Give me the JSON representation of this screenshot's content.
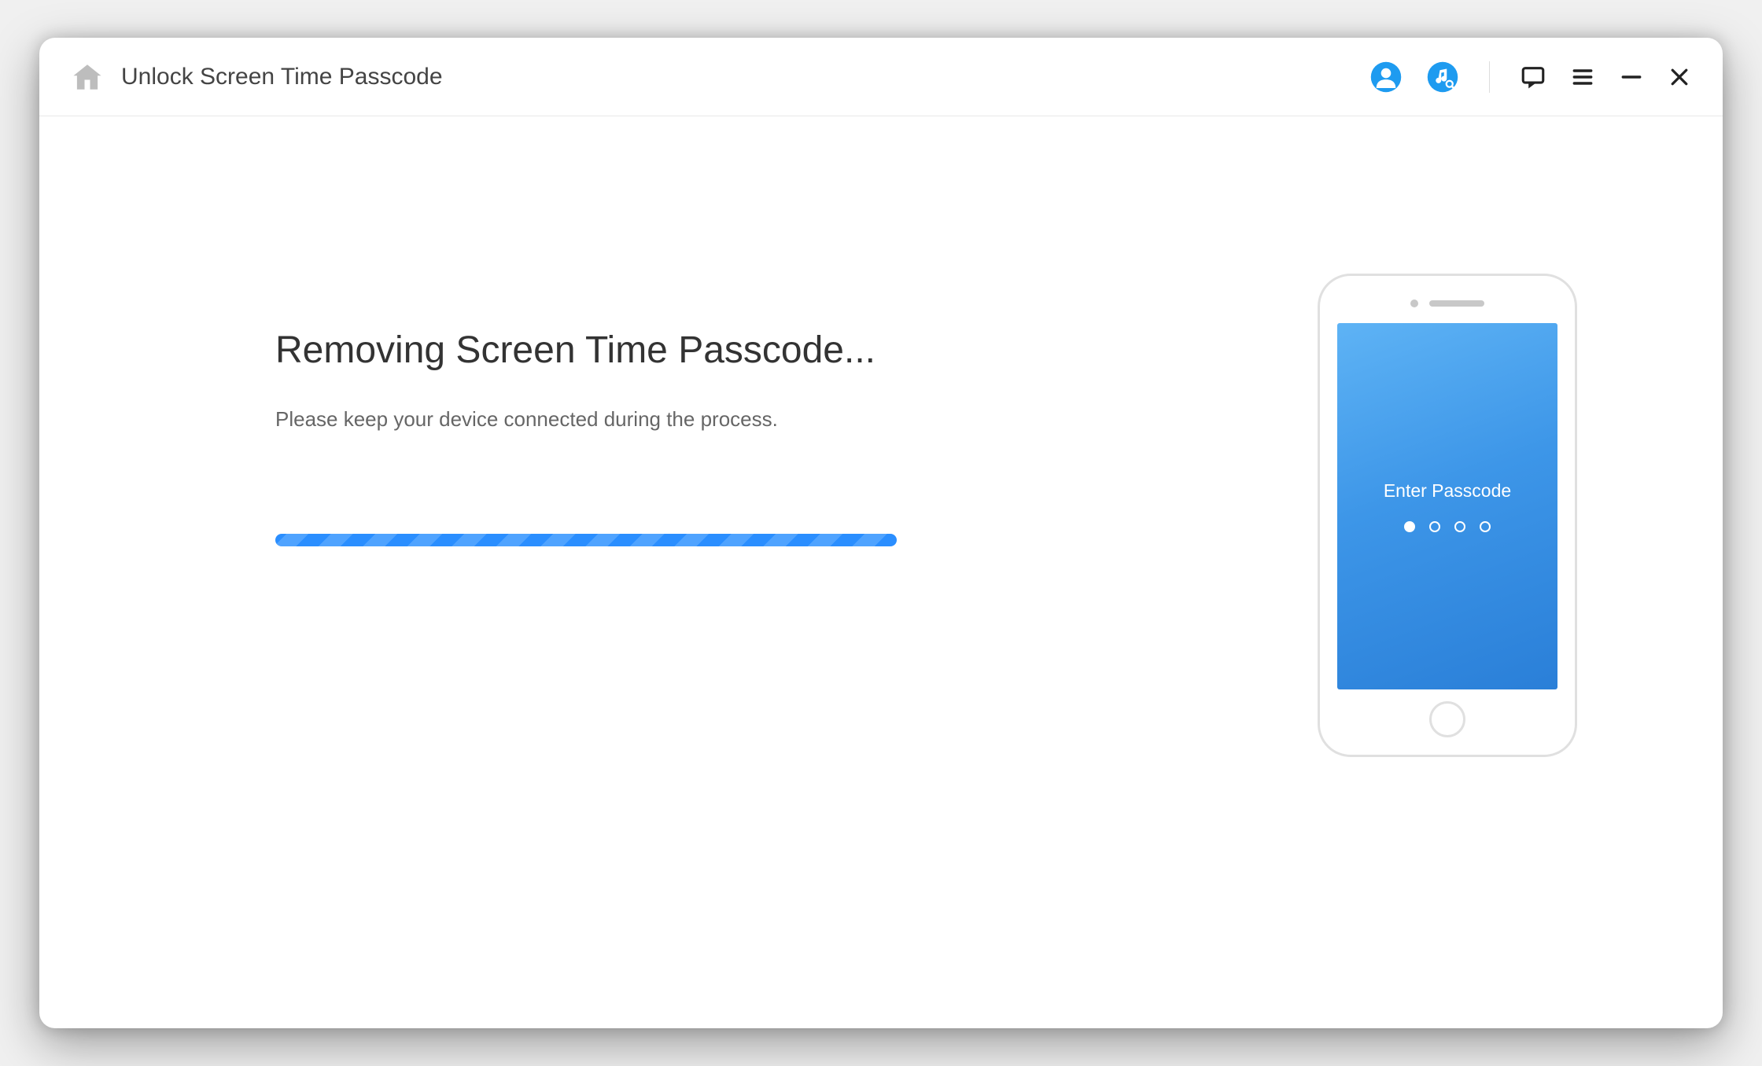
{
  "titlebar": {
    "title": "Unlock Screen Time Passcode"
  },
  "main": {
    "heading": "Removing Screen Time Passcode...",
    "subtext": "Please keep your device connected during the process."
  },
  "phone": {
    "screen_text": "Enter Passcode"
  },
  "colors": {
    "accent": "#1e9bf0"
  }
}
